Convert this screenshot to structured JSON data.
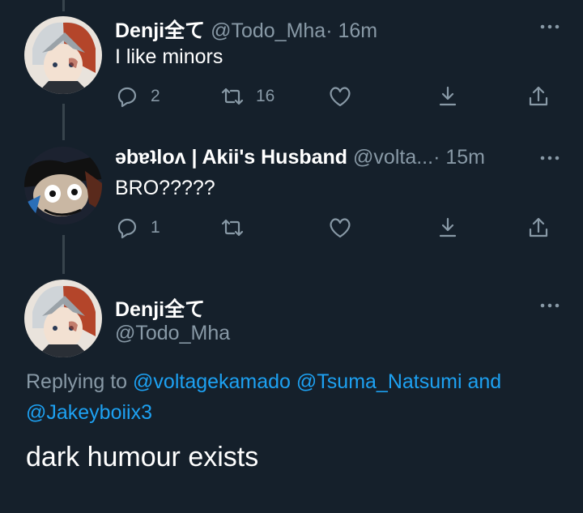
{
  "tweets": [
    {
      "name": "Denji全て",
      "handle": "@Todo_Mha",
      "time": "· 16m",
      "text": "I like minors",
      "reply_count": "2",
      "retweet_count": "16",
      "like_count": ""
    },
    {
      "name": "ǝbɐʇloʌ | Akii's Husband",
      "handle": "@volta...",
      "time": "· 15m",
      "text": "BRO?????",
      "reply_count": "1",
      "retweet_count": "",
      "like_count": ""
    }
  ],
  "main_tweet": {
    "name": "Denji全て",
    "handle": "@Todo_Mha",
    "replying_prefix": "Replying to",
    "mention_1": "@voltagekamado",
    "mention_2": "@Tsuma_Natsumi",
    "and_word": "and",
    "mention_3": "@Jakeyboiix3",
    "text": "dark humour exists"
  },
  "icons": {
    "reply": "reply-icon",
    "retweet": "retweet-icon",
    "like": "heart-icon",
    "save": "bookmark-download-icon",
    "share": "share-icon",
    "more": "more-dots-icon"
  },
  "colors": {
    "background": "#15202b",
    "secondary_text": "#8899a6",
    "link": "#1da1f2",
    "thread_line": "#38444d"
  }
}
